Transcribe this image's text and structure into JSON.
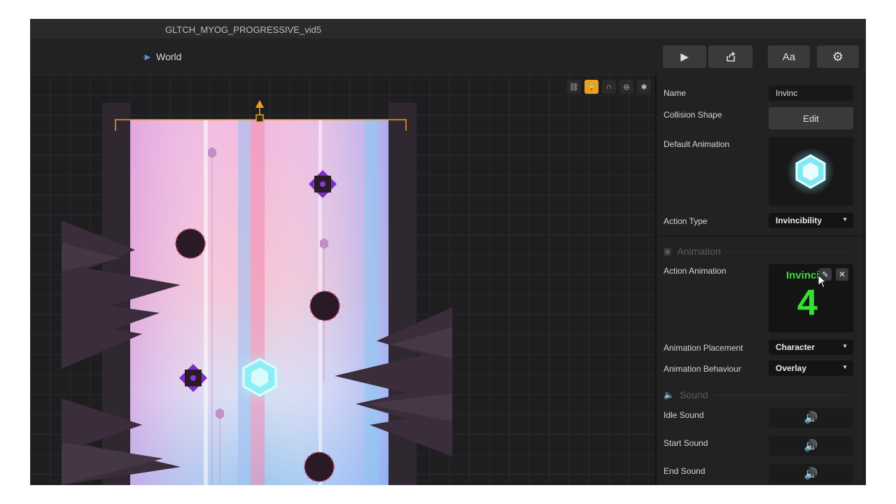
{
  "window": {
    "title": "GLTCH_MYOG_PROGRESSIVE_vid5"
  },
  "breadcrumb": {
    "label": "World"
  },
  "toolbar": {
    "play_icon": "play-icon",
    "export_icon": "export-icon",
    "font_label": "Aa",
    "settings_icon": "gear-icon"
  },
  "canvas_tools": [
    "group-icon",
    "lock-icon",
    "magnet-icon",
    "link-icon",
    "bug-icon"
  ],
  "properties": {
    "name_label": "Name",
    "name_value": "Invinc",
    "collision_label": "Collision Shape",
    "collision_button": "Edit",
    "default_animation_label": "Default Animation",
    "action_type_label": "Action Type",
    "action_type_value": "Invincibility"
  },
  "animation": {
    "section_label": "Animation",
    "action_animation_label": "Action Animation",
    "preview_text": "Invinci",
    "preview_number": "4",
    "placement_label": "Animation Placement",
    "placement_value": "Character",
    "behaviour_label": "Animation Behaviour",
    "behaviour_value": "Overlay"
  },
  "sound": {
    "section_label": "Sound",
    "idle_label": "Idle Sound",
    "start_label": "Start Sound",
    "end_label": "End Sound"
  },
  "colors": {
    "accent": "#f0a020",
    "preview_green": "#33e033",
    "hex_cyan": "#7fe9f0"
  }
}
